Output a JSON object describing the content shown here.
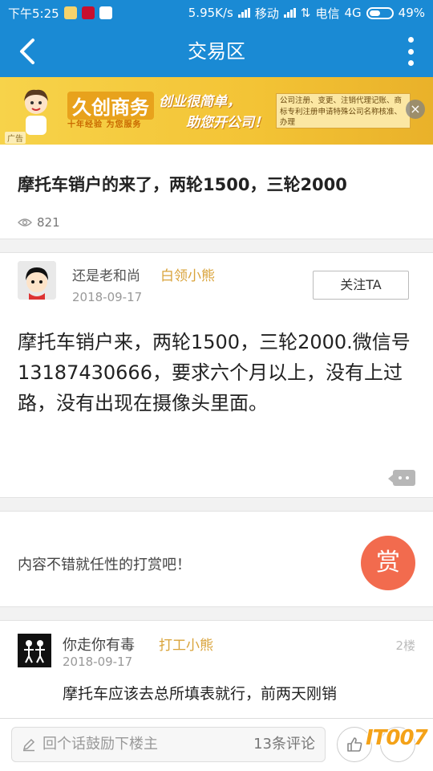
{
  "status_bar": {
    "time": "下午5:25",
    "speed": "5.95K/s",
    "carrier1": "移动",
    "carrier2": "电信",
    "network": "4G",
    "battery": "49%",
    "battery_level": 0.49
  },
  "nav": {
    "title": "交易区"
  },
  "ad": {
    "brand": "久创商务",
    "brand_sub": "十年经验 为您服务",
    "slogan_line1": "创业很简单，",
    "slogan_line2": "助您开公司！",
    "info": "公司注册、变更、注销代理记账、商标专利注册申请特殊公司名称核准、办理",
    "close": "×",
    "tag": "广告"
  },
  "post": {
    "title": "摩托车销户的来了，两轮1500，三轮2000",
    "views": "821",
    "author": "还是老和尚",
    "author_tag": "白领小熊",
    "date": "2018-09-17",
    "follow_label": "关注TA",
    "body": "摩托车销户来，两轮1500，三轮2000.微信号13187430666，要求六个月以上，没有上过路，没有出现在摄像头里面。"
  },
  "reward": {
    "text": "内容不错就任性的打赏吧！",
    "button": "赏"
  },
  "reply": {
    "name": "你走你有毒",
    "tag": "打工小熊",
    "floor": "2楼",
    "date": "2018-09-17",
    "body": "摩托车应该去总所填表就行，前两天刚销"
  },
  "bottom_bar": {
    "placeholder": "回个话鼓励下楼主",
    "comment_count": "13条评论"
  },
  "watermark": "IT007",
  "colors": {
    "primary": "#1a8ad4",
    "tag": "#d9a33a",
    "reward": "#f26b4e"
  }
}
